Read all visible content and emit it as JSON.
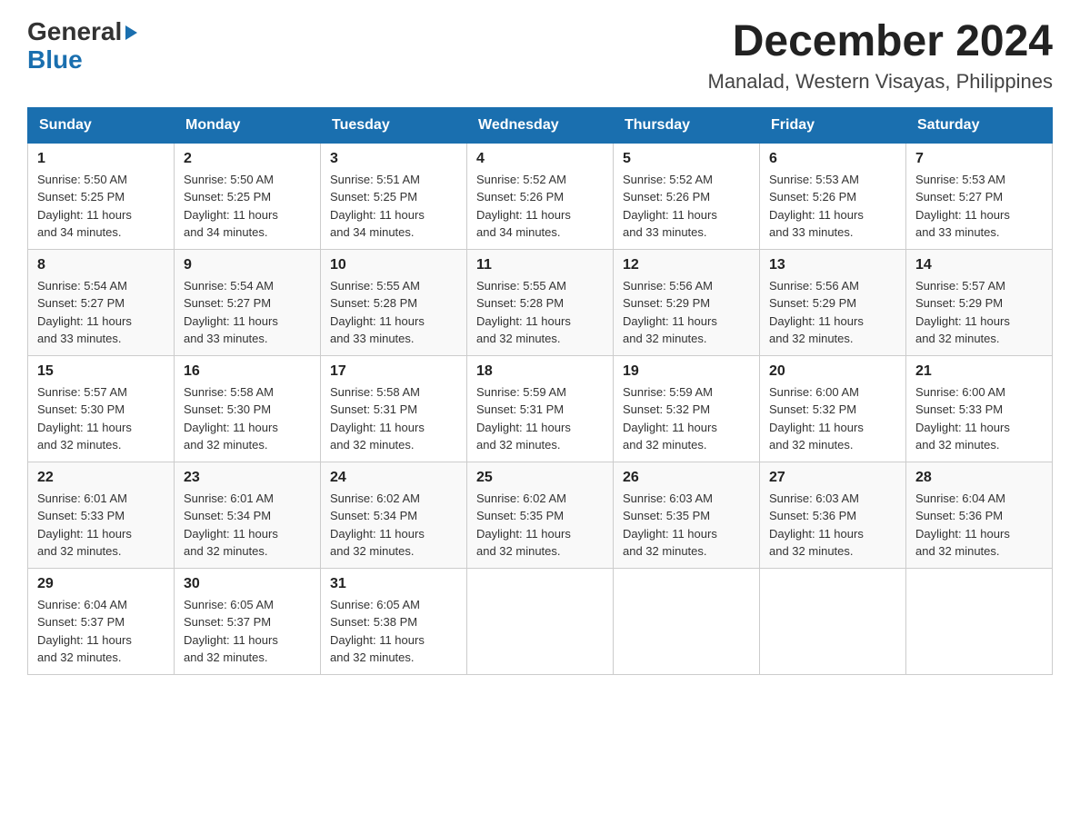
{
  "logo": {
    "general": "General",
    "blue": "Blue",
    "arrowChar": "▶"
  },
  "title": "December 2024",
  "subtitle": "Manalad, Western Visayas, Philippines",
  "headers": [
    "Sunday",
    "Monday",
    "Tuesday",
    "Wednesday",
    "Thursday",
    "Friday",
    "Saturday"
  ],
  "weeks": [
    [
      {
        "day": "1",
        "sunrise": "5:50 AM",
        "sunset": "5:25 PM",
        "daylight": "11 hours and 34 minutes."
      },
      {
        "day": "2",
        "sunrise": "5:50 AM",
        "sunset": "5:25 PM",
        "daylight": "11 hours and 34 minutes."
      },
      {
        "day": "3",
        "sunrise": "5:51 AM",
        "sunset": "5:25 PM",
        "daylight": "11 hours and 34 minutes."
      },
      {
        "day": "4",
        "sunrise": "5:52 AM",
        "sunset": "5:26 PM",
        "daylight": "11 hours and 34 minutes."
      },
      {
        "day": "5",
        "sunrise": "5:52 AM",
        "sunset": "5:26 PM",
        "daylight": "11 hours and 33 minutes."
      },
      {
        "day": "6",
        "sunrise": "5:53 AM",
        "sunset": "5:26 PM",
        "daylight": "11 hours and 33 minutes."
      },
      {
        "day": "7",
        "sunrise": "5:53 AM",
        "sunset": "5:27 PM",
        "daylight": "11 hours and 33 minutes."
      }
    ],
    [
      {
        "day": "8",
        "sunrise": "5:54 AM",
        "sunset": "5:27 PM",
        "daylight": "11 hours and 33 minutes."
      },
      {
        "day": "9",
        "sunrise": "5:54 AM",
        "sunset": "5:27 PM",
        "daylight": "11 hours and 33 minutes."
      },
      {
        "day": "10",
        "sunrise": "5:55 AM",
        "sunset": "5:28 PM",
        "daylight": "11 hours and 33 minutes."
      },
      {
        "day": "11",
        "sunrise": "5:55 AM",
        "sunset": "5:28 PM",
        "daylight": "11 hours and 32 minutes."
      },
      {
        "day": "12",
        "sunrise": "5:56 AM",
        "sunset": "5:29 PM",
        "daylight": "11 hours and 32 minutes."
      },
      {
        "day": "13",
        "sunrise": "5:56 AM",
        "sunset": "5:29 PM",
        "daylight": "11 hours and 32 minutes."
      },
      {
        "day": "14",
        "sunrise": "5:57 AM",
        "sunset": "5:29 PM",
        "daylight": "11 hours and 32 minutes."
      }
    ],
    [
      {
        "day": "15",
        "sunrise": "5:57 AM",
        "sunset": "5:30 PM",
        "daylight": "11 hours and 32 minutes."
      },
      {
        "day": "16",
        "sunrise": "5:58 AM",
        "sunset": "5:30 PM",
        "daylight": "11 hours and 32 minutes."
      },
      {
        "day": "17",
        "sunrise": "5:58 AM",
        "sunset": "5:31 PM",
        "daylight": "11 hours and 32 minutes."
      },
      {
        "day": "18",
        "sunrise": "5:59 AM",
        "sunset": "5:31 PM",
        "daylight": "11 hours and 32 minutes."
      },
      {
        "day": "19",
        "sunrise": "5:59 AM",
        "sunset": "5:32 PM",
        "daylight": "11 hours and 32 minutes."
      },
      {
        "day": "20",
        "sunrise": "6:00 AM",
        "sunset": "5:32 PM",
        "daylight": "11 hours and 32 minutes."
      },
      {
        "day": "21",
        "sunrise": "6:00 AM",
        "sunset": "5:33 PM",
        "daylight": "11 hours and 32 minutes."
      }
    ],
    [
      {
        "day": "22",
        "sunrise": "6:01 AM",
        "sunset": "5:33 PM",
        "daylight": "11 hours and 32 minutes."
      },
      {
        "day": "23",
        "sunrise": "6:01 AM",
        "sunset": "5:34 PM",
        "daylight": "11 hours and 32 minutes."
      },
      {
        "day": "24",
        "sunrise": "6:02 AM",
        "sunset": "5:34 PM",
        "daylight": "11 hours and 32 minutes."
      },
      {
        "day": "25",
        "sunrise": "6:02 AM",
        "sunset": "5:35 PM",
        "daylight": "11 hours and 32 minutes."
      },
      {
        "day": "26",
        "sunrise": "6:03 AM",
        "sunset": "5:35 PM",
        "daylight": "11 hours and 32 minutes."
      },
      {
        "day": "27",
        "sunrise": "6:03 AM",
        "sunset": "5:36 PM",
        "daylight": "11 hours and 32 minutes."
      },
      {
        "day": "28",
        "sunrise": "6:04 AM",
        "sunset": "5:36 PM",
        "daylight": "11 hours and 32 minutes."
      }
    ],
    [
      {
        "day": "29",
        "sunrise": "6:04 AM",
        "sunset": "5:37 PM",
        "daylight": "11 hours and 32 minutes."
      },
      {
        "day": "30",
        "sunrise": "6:05 AM",
        "sunset": "5:37 PM",
        "daylight": "11 hours and 32 minutes."
      },
      {
        "day": "31",
        "sunrise": "6:05 AM",
        "sunset": "5:38 PM",
        "daylight": "11 hours and 32 minutes."
      },
      null,
      null,
      null,
      null
    ]
  ],
  "labels": {
    "sunrise": "Sunrise:",
    "sunset": "Sunset:",
    "daylight": "Daylight:"
  },
  "colors": {
    "header_bg": "#1a6faf",
    "header_text": "#ffffff",
    "border": "#9ec3e0"
  }
}
